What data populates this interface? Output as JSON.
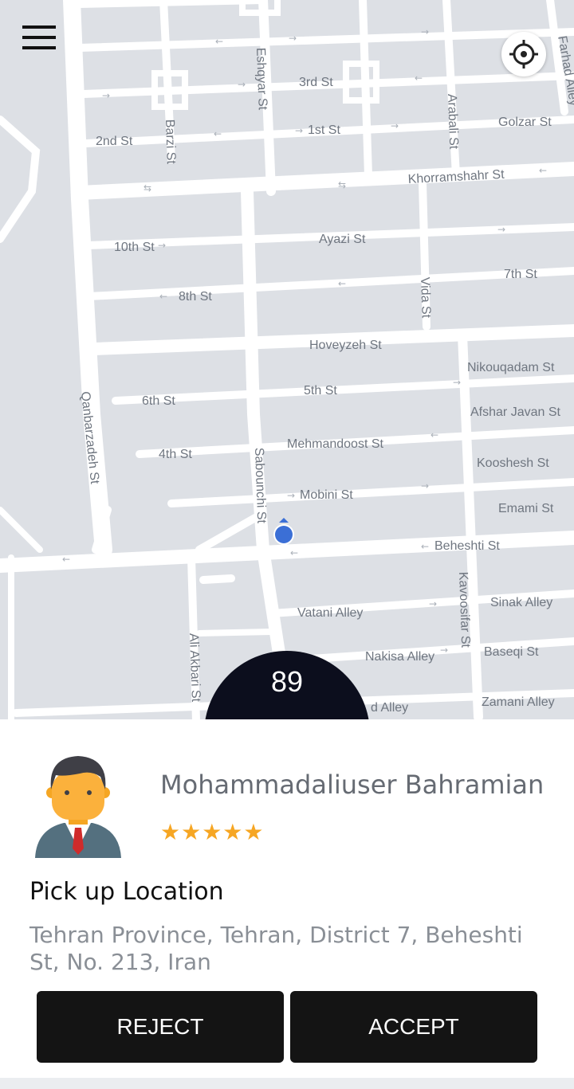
{
  "map": {
    "streets": [
      "Eshqyar St",
      "3rd St",
      "Barzi St",
      "2nd St",
      "1st St",
      "Arabali St",
      "Golzar St",
      "Farhad Alley",
      "Khorramshahr St",
      "10th St",
      "Ayazi St",
      "8th St",
      "7th St",
      "Vida St",
      "Hoveyzeh St",
      "Nikouqadam St",
      "6th St",
      "5th St",
      "Qanbarzadeh St",
      "Afshar Javan St",
      "4th St",
      "Mehmandoost St",
      "Sabounchi St",
      "Kooshesh St",
      "Mobini St",
      "Emami St",
      "Beheshti St",
      "Vatani Alley",
      "Sinak Alley",
      "Kavoosifar St",
      "Ali Akbari St",
      "Nakisa Alley",
      "Baseqi St",
      "d Alley",
      "Zamani Alley"
    ],
    "colors": {
      "background": "#dde0e5",
      "road": "#ffffff",
      "label": "#6f7680",
      "location_dot": "#3b6fd6"
    }
  },
  "menu_icon": "hamburger-menu-icon",
  "locate_icon": "crosshair-icon",
  "countdown": {
    "value": "89"
  },
  "rider": {
    "name": "Mohammadaliuser Bahramian",
    "rating_stars": "★★★★★",
    "rating": 5,
    "avatar_icon": "user-avatar-icon"
  },
  "pickup": {
    "title": "Pick up Location",
    "address": "Tehran Province, Tehran, District 7, Beheshti St, No. 213, Iran"
  },
  "actions": {
    "reject_label": "REJECT",
    "accept_label": "ACCEPT"
  },
  "colors": {
    "button_bg": "#141414",
    "star": "#f6a623",
    "countdown_bg": "#0c0e1d"
  }
}
